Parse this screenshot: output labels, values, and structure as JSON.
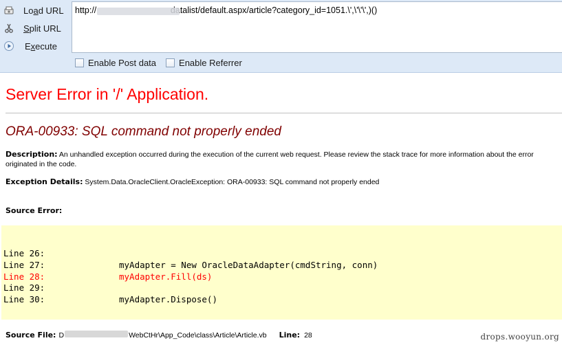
{
  "toolbar": {
    "load_url": {
      "pre": "Lo",
      "key": "a",
      "post": "d URL"
    },
    "split_url": {
      "pre": "",
      "key": "S",
      "post": "plit URL"
    },
    "execute": {
      "pre": "E",
      "key": "x",
      "post": "ecute"
    },
    "url_value": "http://                               datalist/default.aspx/article?category_id=1051.\\',\\'\\'\\',)()",
    "enable_post_data": "Enable Post data",
    "enable_referrer": "Enable Referrer"
  },
  "error_page": {
    "title": "Server Error in '/' Application.",
    "subtitle": "ORA-00933: SQL command not properly ended",
    "description_label": "Description:",
    "description_text": "An unhandled exception occurred during the execution of the current web request. Please review the stack trace for more information about the error originated in the code.",
    "exception_label": "Exception Details:",
    "exception_text": "System.Data.OracleClient.OracleException: ORA-00933: SQL command not properly ended",
    "source_error_label": "Source Error:",
    "source_lines": [
      {
        "num": "Line 26:",
        "code": ""
      },
      {
        "num": "Line 27:",
        "code": "myAdapter = New OracleDataAdapter(cmdString, conn)"
      },
      {
        "num": "Line 28:",
        "code": "myAdapter.Fill(ds)",
        "highlight": true
      },
      {
        "num": "Line 29:",
        "code": ""
      },
      {
        "num": "Line 30:",
        "code": "myAdapter.Dispose()"
      }
    ],
    "source_file_label": "Source File:",
    "source_file_prefix": "D",
    "source_file_path": "WebCtHr\\App_Code\\class\\Article\\Article.vb",
    "line_label": "Line:",
    "line_value": "28"
  },
  "watermark": "drops.wooyun.org",
  "colors": {
    "toolbar_bg": "#dde9f7",
    "error_title": "#ff0000",
    "error_subtitle": "#800000",
    "code_bg": "#ffffcc",
    "highlight": "#ff0000"
  },
  "icons": [
    "load-url-icon",
    "split-url-icon",
    "execute-icon"
  ]
}
